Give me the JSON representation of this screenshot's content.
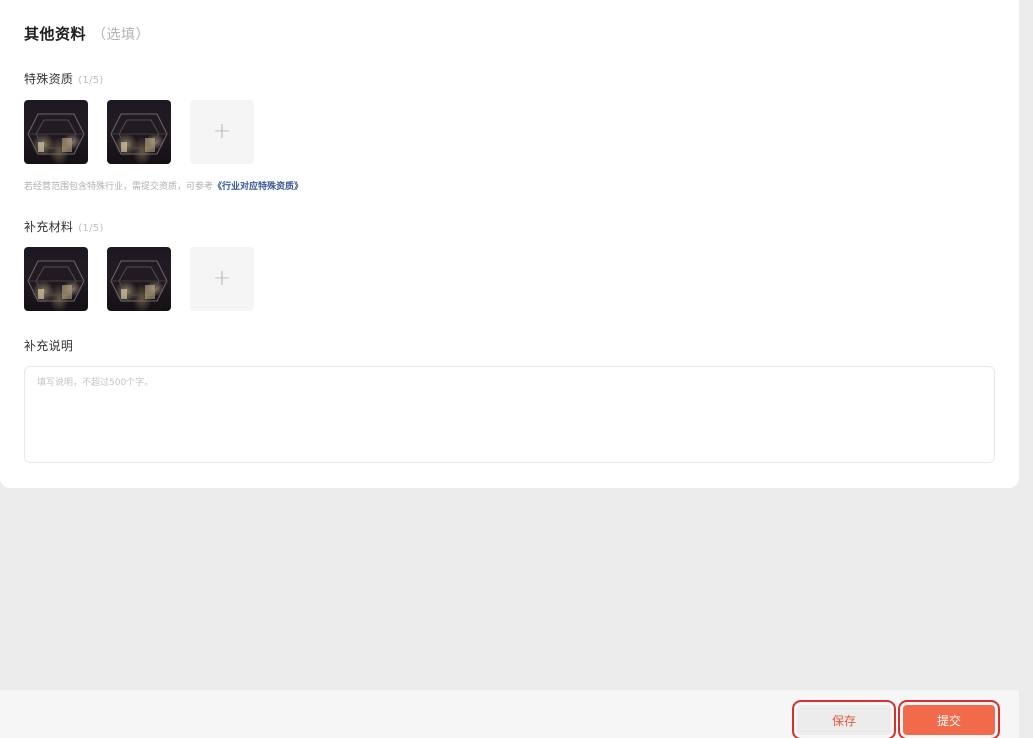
{
  "section": {
    "title": "其他资料",
    "optional": "（选填）"
  },
  "special_qualification": {
    "label": "特殊资质",
    "count": "(1/5)",
    "thumbnails": [
      "uploaded-image-1",
      "uploaded-image-2"
    ],
    "add_symbol": "+",
    "hint_prefix": "若经营范围包含特殊行业，需提交资质，可参考",
    "hint_link": "《行业对应特殊资质》"
  },
  "supplementary_material": {
    "label": "补充材料",
    "count": "(1/5)",
    "thumbnails": [
      "uploaded-image-1",
      "uploaded-image-2"
    ],
    "add_symbol": "+"
  },
  "supplementary_note": {
    "label": "补充说明",
    "placeholder": "填写说明，不超过500个字。",
    "value": ""
  },
  "footer": {
    "save_label": "保存",
    "submit_label": "提交"
  },
  "colors": {
    "accent": "#f06a4b",
    "highlight_outline": "#d62f2f",
    "link": "#3b5998"
  }
}
